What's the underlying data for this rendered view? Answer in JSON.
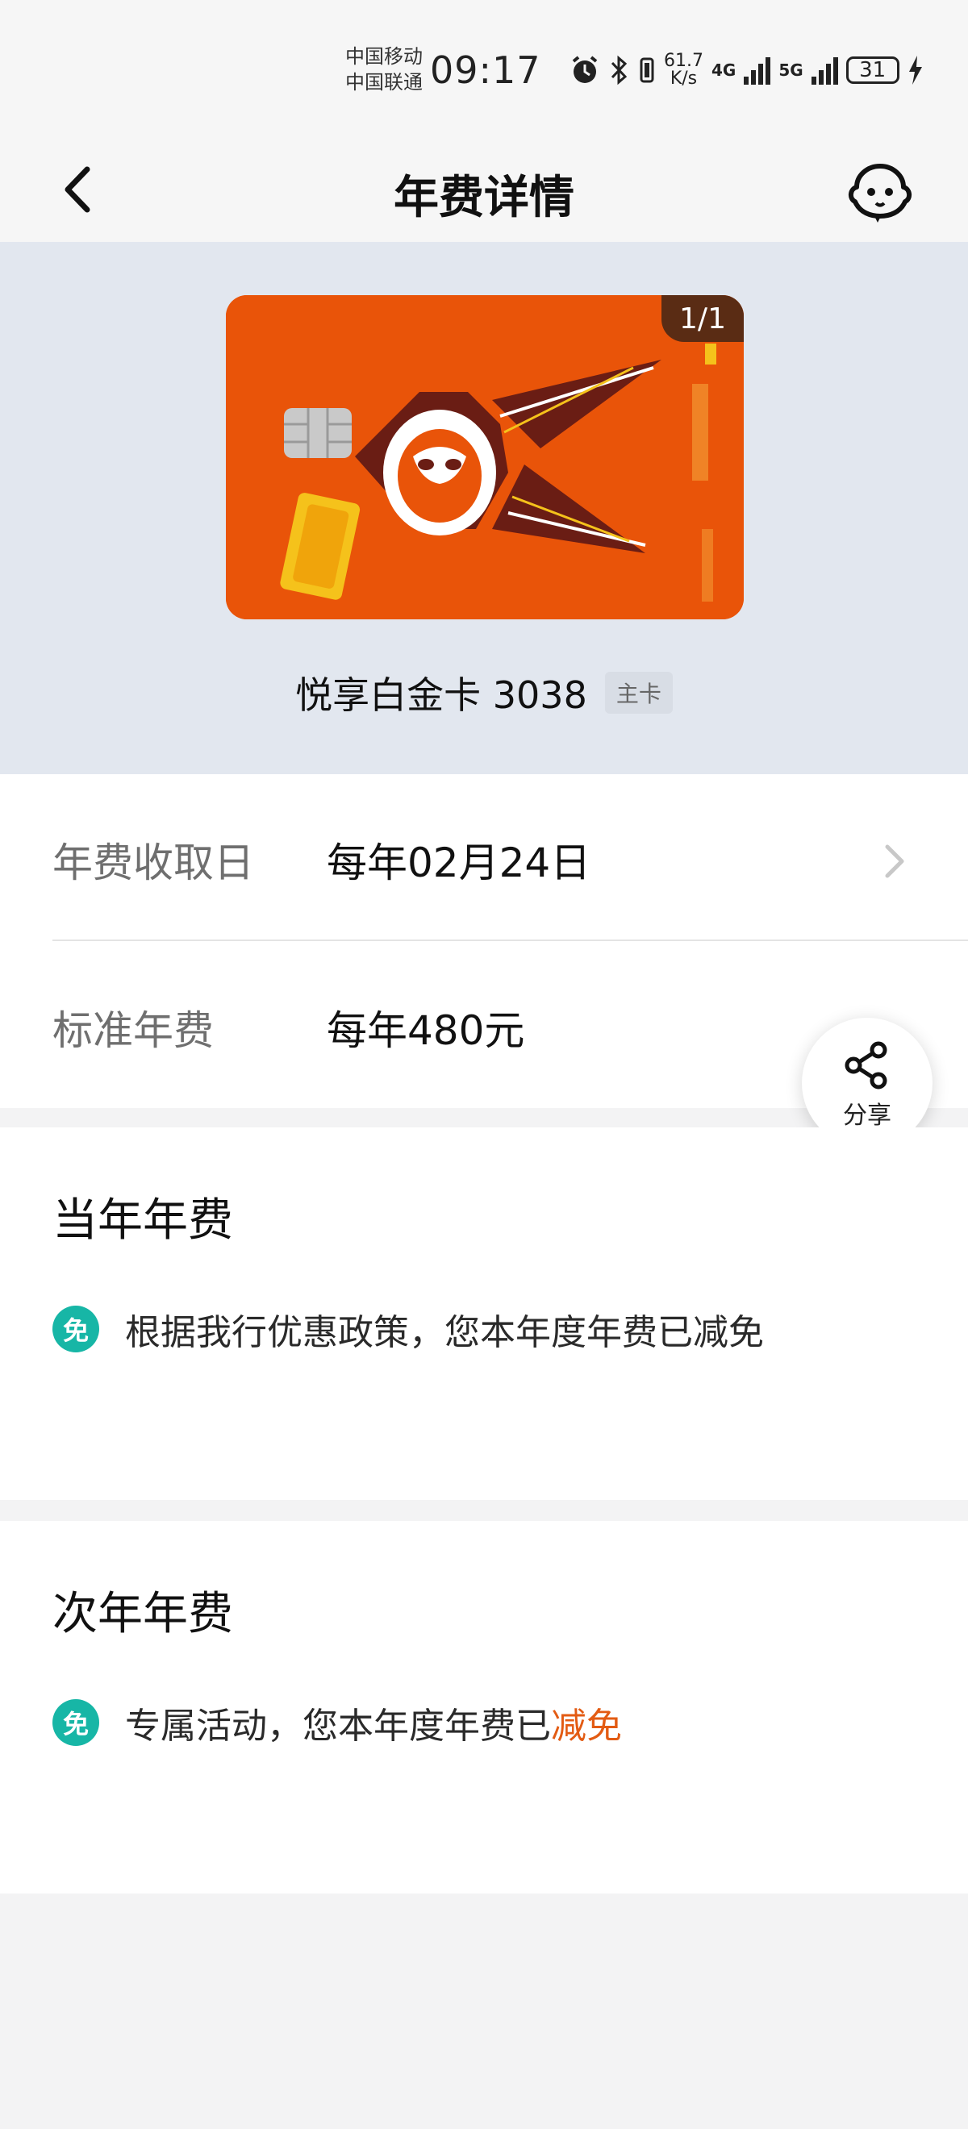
{
  "status_bar": {
    "carrier_1": "中国移动",
    "carrier_2": "中国联通",
    "time": "09:17",
    "net_speed_value": "61.7",
    "net_speed_unit": "K/s",
    "net_1": "4G",
    "net_2": "5G",
    "battery": "31",
    "icons": [
      "alarm-icon",
      "bluetooth-icon",
      "vibrate-icon",
      "signal-icon",
      "charging-icon"
    ]
  },
  "header": {
    "title": "年费详情",
    "back_icon": "back-chevron-icon",
    "assistant_icon": "robot-assistant-icon"
  },
  "card": {
    "pager": "1/1",
    "name": "悦享白金卡 3038",
    "tag": "主卡",
    "colors": {
      "card": "#e95409",
      "area_bg": "#e2e7ef"
    }
  },
  "fee_info": {
    "rows": [
      {
        "label": "年费收取日",
        "value": "每年02月24日"
      },
      {
        "label": "标准年费",
        "value": "每年480元"
      }
    ]
  },
  "share": {
    "label": "分享",
    "icon": "share-icon"
  },
  "current_year": {
    "title": "当年年费",
    "badge": "免",
    "text": "根据我行优惠政策，您本年度年费已减免"
  },
  "next_year": {
    "title": "次年年费",
    "badge": "免",
    "text_prefix": "专属活动，您本年度年费已",
    "text_highlight": "减免"
  },
  "colors": {
    "accent": "#17b6a6",
    "highlight": "#e35b13"
  }
}
